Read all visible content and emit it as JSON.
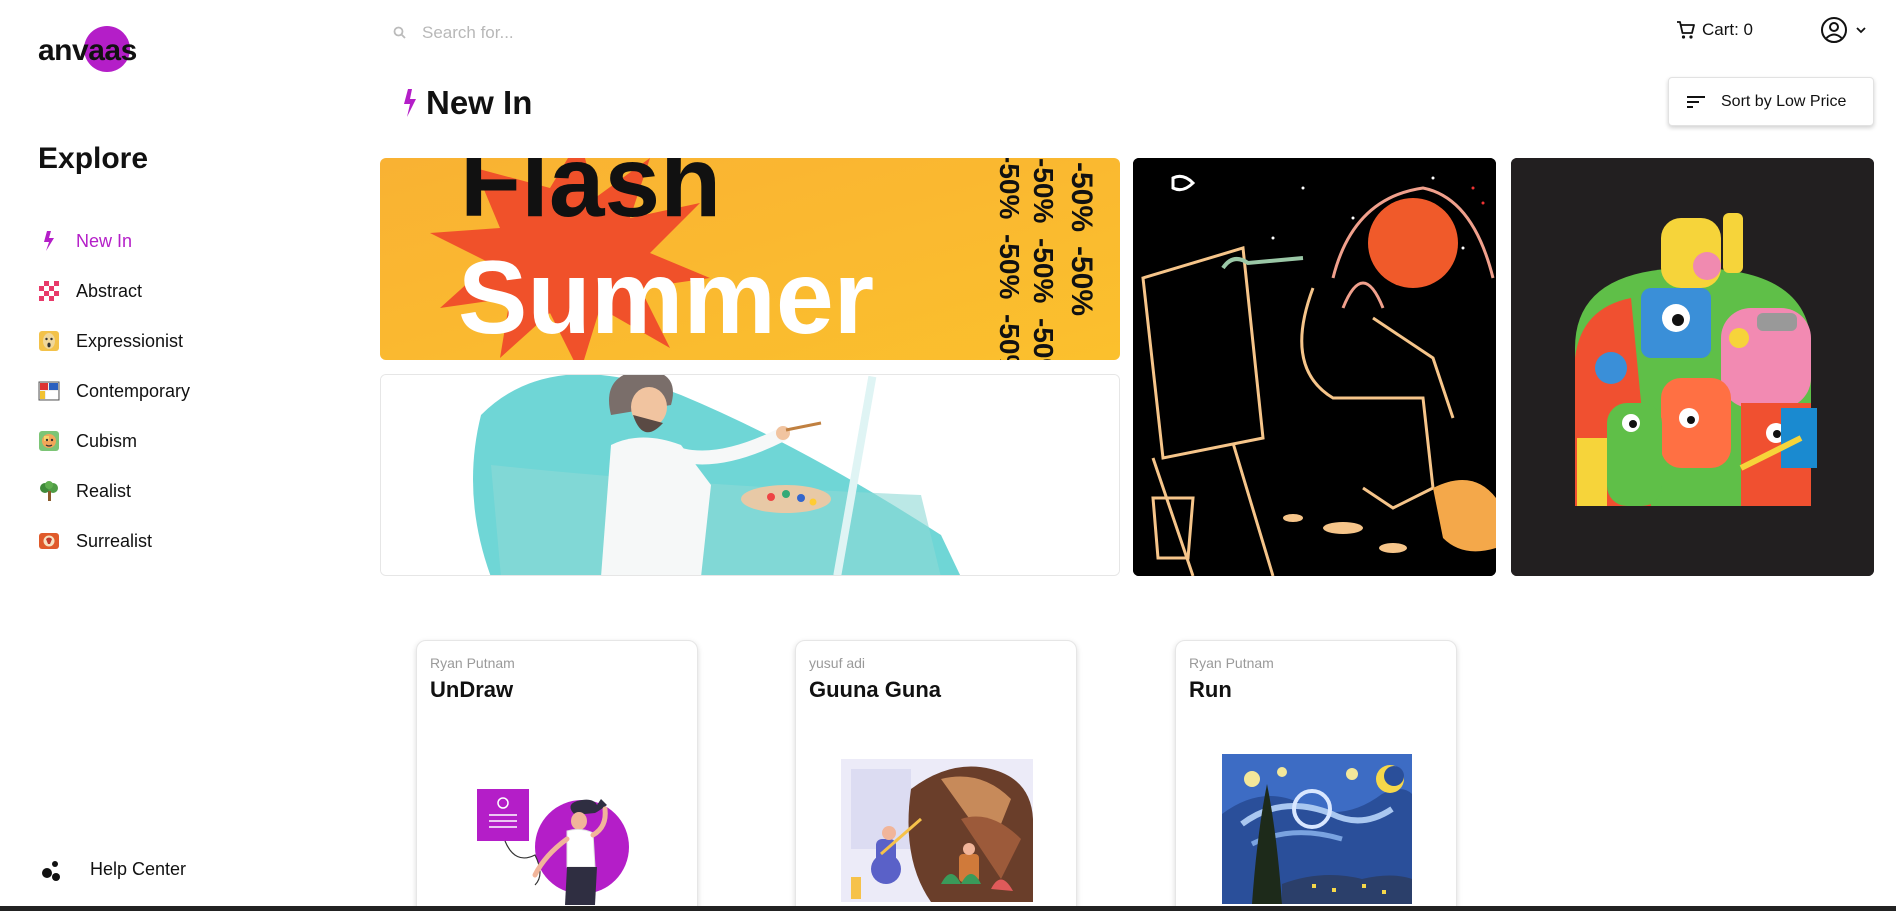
{
  "brand": {
    "logo_text": "anvaas",
    "accent": "#b41ec8"
  },
  "sidebar": {
    "title": "Explore",
    "items": [
      {
        "label": "New In",
        "icon": "bolt-icon",
        "active": true
      },
      {
        "label": "Abstract",
        "icon": "checker-icon",
        "active": false
      },
      {
        "label": "Expressionist",
        "icon": "scream-face-icon",
        "active": false
      },
      {
        "label": "Contemporary",
        "icon": "grid-art-icon",
        "active": false
      },
      {
        "label": "Cubism",
        "icon": "cubist-face-icon",
        "active": false
      },
      {
        "label": "Realist",
        "icon": "tree-icon",
        "active": false
      },
      {
        "label": "Surrealist",
        "icon": "surreal-icon",
        "active": false
      }
    ],
    "help_label": "Help Center"
  },
  "search": {
    "placeholder": "Search for..."
  },
  "cart": {
    "label": "Cart: 0"
  },
  "page": {
    "title": "New In",
    "sort_label": "Sort by Low Price"
  },
  "banners": {
    "summer": {
      "line1": "Flash",
      "line2": "Summer",
      "promo": "-50%"
    }
  },
  "products": [
    {
      "author": "Ryan Putnam",
      "title": "UnDraw"
    },
    {
      "author": "yusuf adi",
      "title": "Guuna Guna"
    },
    {
      "author": "Ryan Putnam",
      "title": "Run"
    }
  ]
}
